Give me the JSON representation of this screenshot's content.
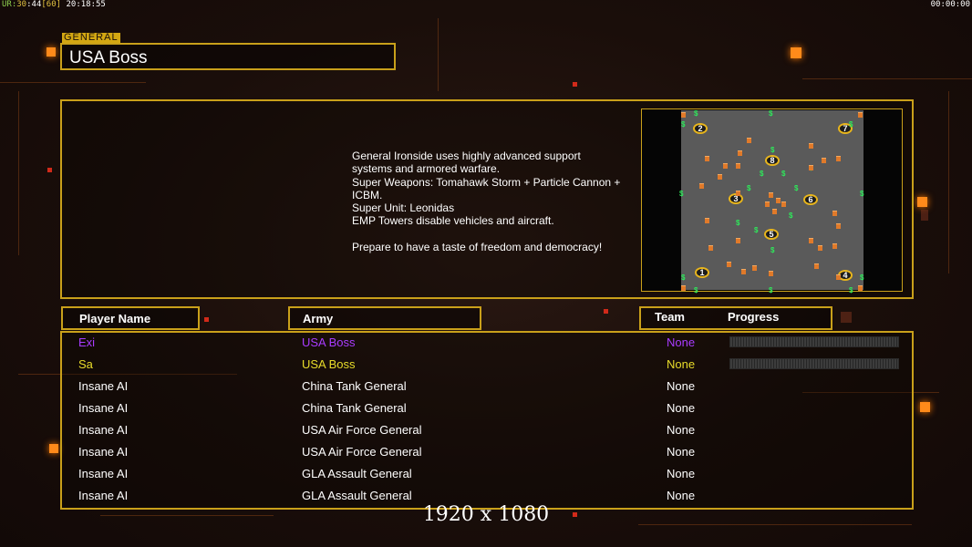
{
  "topbar": {
    "fps_a": "UR:",
    "fps_b": "30",
    "fps_c": ":44",
    "fps_d": "[60]",
    "fps_time": " 20:18:55",
    "clock": "00:00:00"
  },
  "general": {
    "label": "GENERAL",
    "name": "USA Boss",
    "description": "General Ironside uses highly advanced support\n systems and armored warfare.\nSuper Weapons: Tomahawk Storm + Particle Cannon +\n ICBM.\nSuper Unit: Leonidas\nEMP Towers disable vehicles and aircraft.\n\nPrepare to have a taste of freedom and democracy!"
  },
  "map": {
    "start_positions": [
      "1",
      "2",
      "3",
      "4",
      "5",
      "6",
      "7",
      "8"
    ],
    "resource_glyph": "$",
    "colors": {
      "field": "#5a5a5a",
      "marker_ring": "#e8b51c",
      "resource": "#2ee85a",
      "building": "#e07a2a"
    }
  },
  "table": {
    "headers": {
      "player": "Player Name",
      "army": "Army",
      "team": "Team",
      "progress": "Progress"
    },
    "rows": [
      {
        "name": "Exi",
        "army": "USA Boss",
        "team": "None",
        "color": "#a93cff",
        "progress": 0
      },
      {
        "name": "Sa",
        "army": "USA Boss",
        "team": "None",
        "color": "#e8dc2a",
        "progress": 0
      },
      {
        "name": "Insane AI",
        "army": "China Tank General",
        "team": "None",
        "color": "#ffffff"
      },
      {
        "name": "Insane AI",
        "army": "China Tank General",
        "team": "None",
        "color": "#ffffff"
      },
      {
        "name": "Insane AI",
        "army": "USA Air Force General",
        "team": "None",
        "color": "#ffffff"
      },
      {
        "name": "Insane AI",
        "army": "USA Air Force General",
        "team": "None",
        "color": "#ffffff"
      },
      {
        "name": "Insane AI",
        "army": "GLA Assault General",
        "team": "None",
        "color": "#ffffff"
      },
      {
        "name": "Insane AI",
        "army": "GLA Assault General",
        "team": "None",
        "color": "#ffffff"
      }
    ]
  },
  "resolution_label": "1920 x 1080",
  "colors": {
    "accent": "#c9a01a",
    "glow": "#ff8a1a",
    "background": "#1a0f0b"
  }
}
